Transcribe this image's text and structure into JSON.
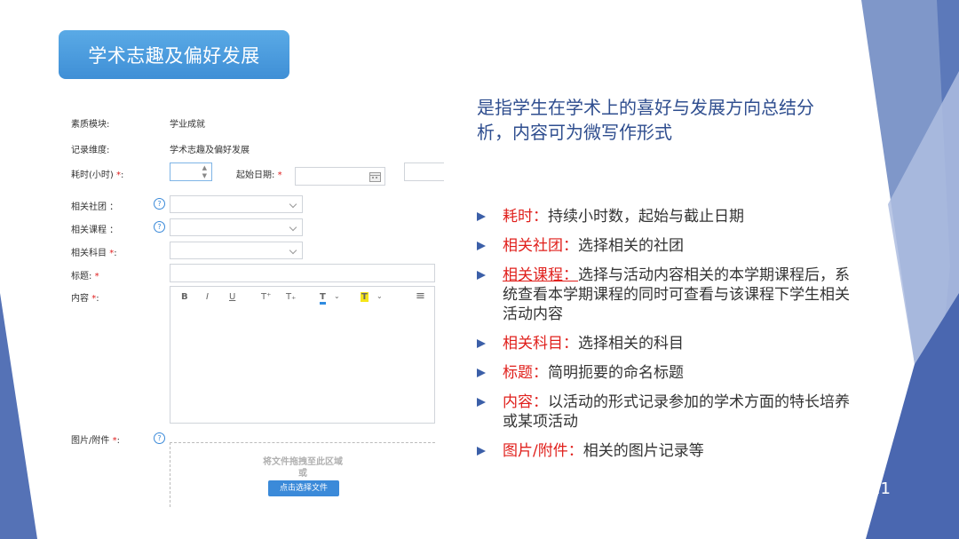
{
  "slide": {
    "title": "学术志趣及偏好发展",
    "page_number": "11",
    "description": "是指学生在学术上的喜好与发展方向总结分析，内容可为微写作形式"
  },
  "form": {
    "module_label": "素质模块:",
    "module_value": "学业成就",
    "dimension_label": "记录维度:",
    "dimension_value": "学术志趣及偏好发展",
    "hours_label": "耗时(小时)",
    "start_date_label": "起始日期:",
    "required_mark": "*",
    "date_dash": "-",
    "club_label": "相关社团 ：",
    "course_label": "相关课程 ：",
    "subject_label": "相关科目",
    "title_label": "标题:",
    "content_label": "内容",
    "attachment_label": "图片/附件",
    "colon": ":",
    "help_glyph": "?",
    "toolbar": {
      "bold": "B",
      "italic": "I",
      "underline": "U",
      "superscript": "T⁺",
      "subscript": "T₊",
      "font_color": "T",
      "highlight": "T",
      "align": "≡"
    },
    "drop_text": "将文件拖拽至此区域",
    "or_text": "或",
    "upload_button": "点击选择文件"
  },
  "bullets": [
    {
      "term": "耗时",
      "sep": "：",
      "text": "持续小时数，起始与截止日期",
      "underline": false
    },
    {
      "term": "相关社团",
      "sep": "：",
      "text": "选择相关的社团",
      "underline": false
    },
    {
      "term": "相关课程",
      "sep": "：",
      "text": "选择与活动内容相关的本学期课程后，系统查看本学期课程的同时可查看与该课程下学生相关活动内容",
      "underline": true
    },
    {
      "term": "相关科目",
      "sep": "：",
      "text": "选择相关的科目",
      "underline": false
    },
    {
      "term": "标题",
      "sep": "：",
      "text": "简明扼要的命名标题",
      "underline": false
    },
    {
      "term": "内容",
      "sep": "：",
      "text": "以活动的形式记录参加的学术方面的特长培养或某项活动",
      "underline": false
    },
    {
      "term": "图片/附件",
      "sep": "：",
      "text": "相关的图片记录等",
      "underline": false
    }
  ],
  "colors": {
    "accent_blue": "#3f8fd6",
    "required_red": "#e02020",
    "term_red": "#e0201c",
    "desc_blue": "#2f4e8f",
    "deco_dark": "#4a67b0"
  }
}
